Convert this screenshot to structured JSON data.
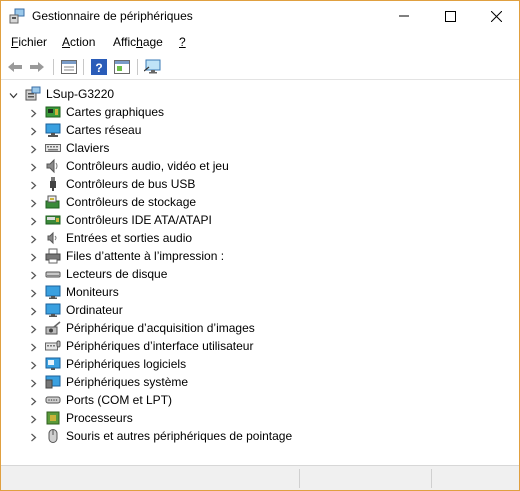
{
  "window": {
    "title": "Gestionnaire de périphériques"
  },
  "menu": [
    {
      "label": "Fichier",
      "key": "F",
      "rest": "ichier"
    },
    {
      "label": "Action",
      "key": "A",
      "rest": "ction"
    },
    {
      "label": "Affichage",
      "pre": "Affic",
      "key": "h",
      "post": "age"
    },
    {
      "label": "?",
      "key": "?",
      "rest": ""
    }
  ],
  "tree": {
    "root": "LSup-G3220",
    "items": [
      {
        "label": "Cartes graphiques",
        "icon": "display-adapter-icon"
      },
      {
        "label": "Cartes réseau",
        "icon": "network-adapter-icon"
      },
      {
        "label": "Claviers",
        "icon": "keyboard-icon"
      },
      {
        "label": "Contrôleurs audio, vidéo et jeu",
        "icon": "speaker-icon"
      },
      {
        "label": "Contrôleurs de bus USB",
        "icon": "usb-icon"
      },
      {
        "label": "Contrôleurs de stockage",
        "icon": "storage-controller-icon"
      },
      {
        "label": "Contrôleurs IDE ATA/ATAPI",
        "icon": "ide-controller-icon"
      },
      {
        "label": "Entrées et sorties audio",
        "icon": "audio-io-icon"
      },
      {
        "label": "Files d’attente à l’impression :",
        "icon": "printer-icon"
      },
      {
        "label": "Lecteurs de disque",
        "icon": "disk-drive-icon"
      },
      {
        "label": "Moniteurs",
        "icon": "monitor-icon"
      },
      {
        "label": "Ordinateur",
        "icon": "computer-icon"
      },
      {
        "label": "Périphérique d’acquisition d’images",
        "icon": "camera-icon"
      },
      {
        "label": "Périphériques d’interface utilisateur",
        "icon": "hid-icon"
      },
      {
        "label": "Périphériques logiciels",
        "icon": "software-device-icon"
      },
      {
        "label": "Périphériques système",
        "icon": "system-device-icon"
      },
      {
        "label": "Ports (COM et LPT)",
        "icon": "port-icon"
      },
      {
        "label": "Processeurs",
        "icon": "processor-icon"
      },
      {
        "label": "Souris et autres périphériques de pointage",
        "icon": "mouse-icon"
      }
    ]
  },
  "toolbar": [
    "back-icon",
    "forward-icon",
    "properties-icon",
    "help-icon",
    "show-hide-icon",
    "scan-hardware-icon"
  ]
}
